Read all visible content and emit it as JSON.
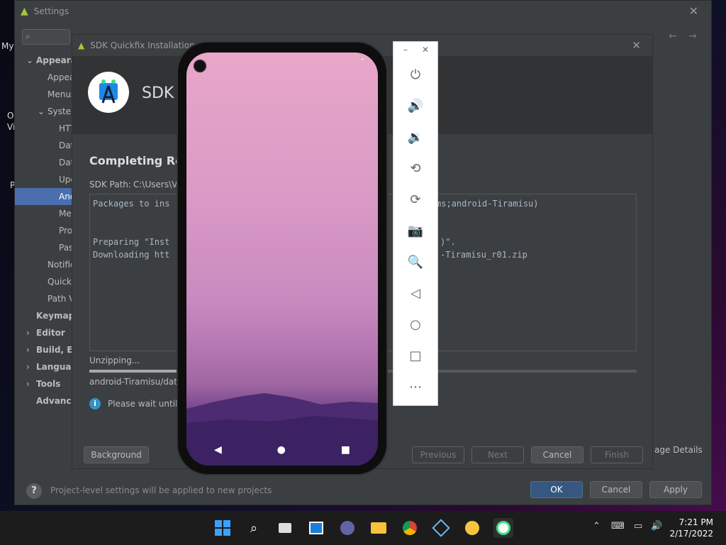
{
  "desktop": {
    "label_my": "My",
    "label_o": "O",
    "label_vi": "Vi",
    "label_p": "P"
  },
  "settings": {
    "title": "Settings",
    "sidebar": [
      {
        "label": "Appearan",
        "bold": true
      },
      {
        "label": "Appear"
      },
      {
        "label": "Menus"
      },
      {
        "label": "System"
      },
      {
        "label": "HTT"
      },
      {
        "label": "Data"
      },
      {
        "label": "Date"
      },
      {
        "label": "Upd"
      },
      {
        "label": "And",
        "selected": true
      },
      {
        "label": "Mem"
      },
      {
        "label": "Pro"
      },
      {
        "label": "Pas"
      },
      {
        "label": "Notific"
      },
      {
        "label": "Quick l"
      },
      {
        "label": "Path Va"
      },
      {
        "label": "Keymap",
        "bold": true
      },
      {
        "label": "Editor",
        "bold": true
      },
      {
        "label": "Build, Exe",
        "bold": true
      },
      {
        "label": "Language",
        "bold": true
      },
      {
        "label": "Tools",
        "bold": true
      },
      {
        "label": "Advanced",
        "bold": true
      }
    ],
    "footer_text": "Project-level settings will be applied to new projects",
    "ok": "OK",
    "cancel": "Cancel",
    "apply": "Apply",
    "package_details": "age Details"
  },
  "dialog": {
    "title": "SDK Quickfix Installation",
    "banner_title": "SDK",
    "heading": "Completing Req",
    "sdk_path_label": "SDK Path:",
    "sdk_path_value": "C:\\Users\\VN",
    "log_line1_a": "Packages to ins",
    "log_line1_b": "ms;android-Tiramisu)",
    "log_line2_a": "Preparing \"Inst",
    "log_line2_b": ")\".",
    "log_line3_a": "Downloading htt",
    "log_line3_b": "-Tiramisu_r01.zip",
    "status": "Unzipping...",
    "progress": 0.16,
    "current_file": "android-Tiramisu/data/",
    "info_text": "Please wait until th",
    "background": "Background",
    "previous": "Previous",
    "next": "Next",
    "cancel": "Cancel",
    "finish": "Finish"
  },
  "emulator": {
    "buttons": [
      "power-icon",
      "volume-up-icon",
      "volume-down-icon",
      "rotate-left-icon",
      "rotate-right-icon",
      "camera-icon",
      "zoom-icon",
      "back-icon",
      "home-icon",
      "overview-icon",
      "more-icon"
    ]
  },
  "taskbar": {
    "time": "7:21 PM",
    "date": "2/17/2022"
  }
}
